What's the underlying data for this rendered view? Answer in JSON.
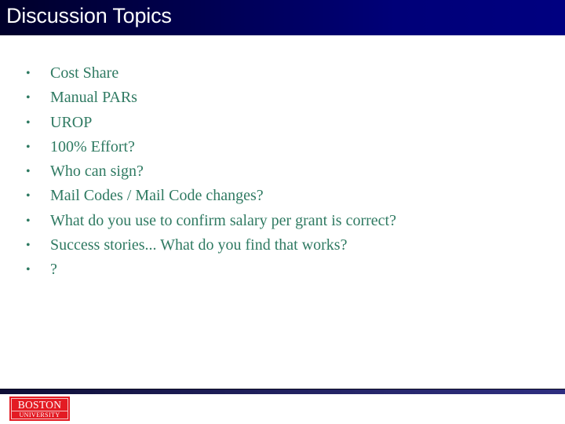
{
  "slide": {
    "title": "Discussion Topics",
    "bullet_glyph": "•",
    "bullets": [
      "Cost Share",
      "Manual PARs",
      "UROP",
      "100% Effort?",
      "Who can sign?",
      "Mail Codes / Mail Code changes?",
      "What do you use to confirm salary per grant is correct?",
      "Success stories... What do you find that works?",
      "?"
    ]
  },
  "footer": {
    "logo": {
      "line1": "BOSTON",
      "line2": "UNIVERSITY"
    }
  },
  "colors": {
    "header_bg": "#000080",
    "title_text": "#ffffff",
    "body_text": "#2f7a62",
    "logo_bg": "#e31b23"
  }
}
